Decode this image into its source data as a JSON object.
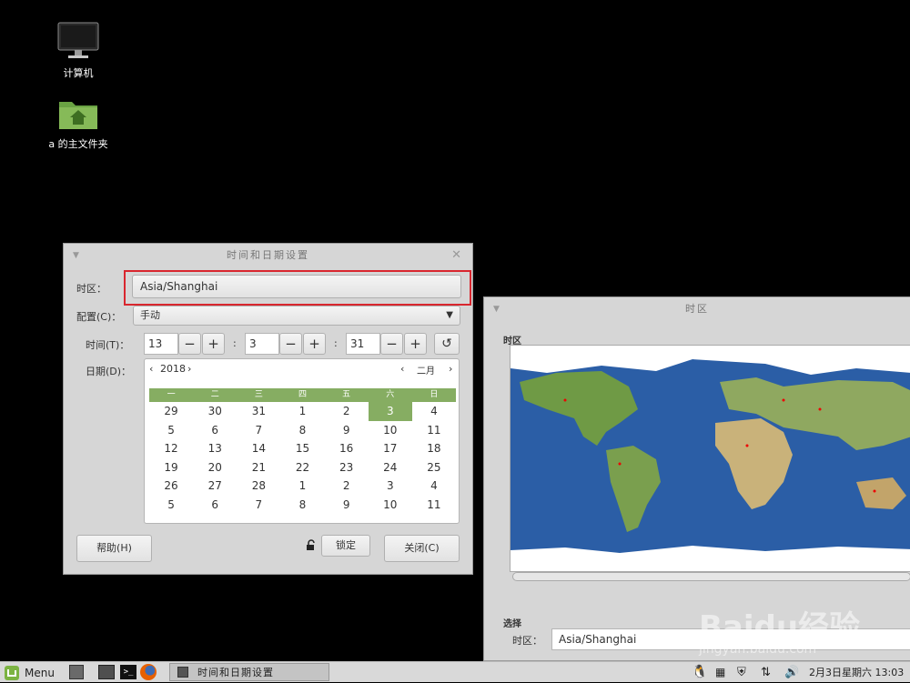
{
  "desktop": {
    "icons": [
      {
        "label": "计算机",
        "icon": "computer-icon"
      },
      {
        "label": "a 的主文件夹",
        "icon": "home-folder-icon"
      }
    ]
  },
  "datetime_window": {
    "title": "时间和日期设置",
    "timezone_label": "时区：",
    "timezone_value": "Asia/Shanghai",
    "config_label": "配置(C)：",
    "config_value": "手动",
    "time_label": "时间(T)：",
    "hour": "13",
    "minute": "3",
    "second": "31",
    "colon": ":",
    "date_label": "日期(D)：",
    "year": "2018",
    "month": "二月",
    "weekdays": [
      "一",
      "二",
      "三",
      "四",
      "五",
      "六",
      "日"
    ],
    "days": [
      "29",
      "30",
      "31",
      "1",
      "2",
      "3",
      "4",
      "5",
      "6",
      "7",
      "8",
      "9",
      "10",
      "11",
      "12",
      "13",
      "14",
      "15",
      "16",
      "17",
      "18",
      "19",
      "20",
      "21",
      "22",
      "23",
      "24",
      "25",
      "26",
      "27",
      "28",
      "1",
      "2",
      "3",
      "4",
      "5",
      "6",
      "7",
      "8",
      "9",
      "10",
      "11"
    ],
    "selected_day_index": 5,
    "help_button": "帮助(H)",
    "lock_button": "锁定",
    "close_button": "关闭(C)",
    "highlight_color": "#d9262e"
  },
  "timezone_window": {
    "title": "时区",
    "map_section_label": "时区",
    "select_section_label": "选择",
    "timezone_label": "时区：",
    "timezone_value": "Asia/Shanghai"
  },
  "taskbar": {
    "menu_label": "Menu",
    "task_label": "时间和日期设置",
    "clock": "2月3日星期六 13:03"
  },
  "watermark": {
    "brand": "Baidu经验",
    "url": "jingyan.baidu.com"
  }
}
